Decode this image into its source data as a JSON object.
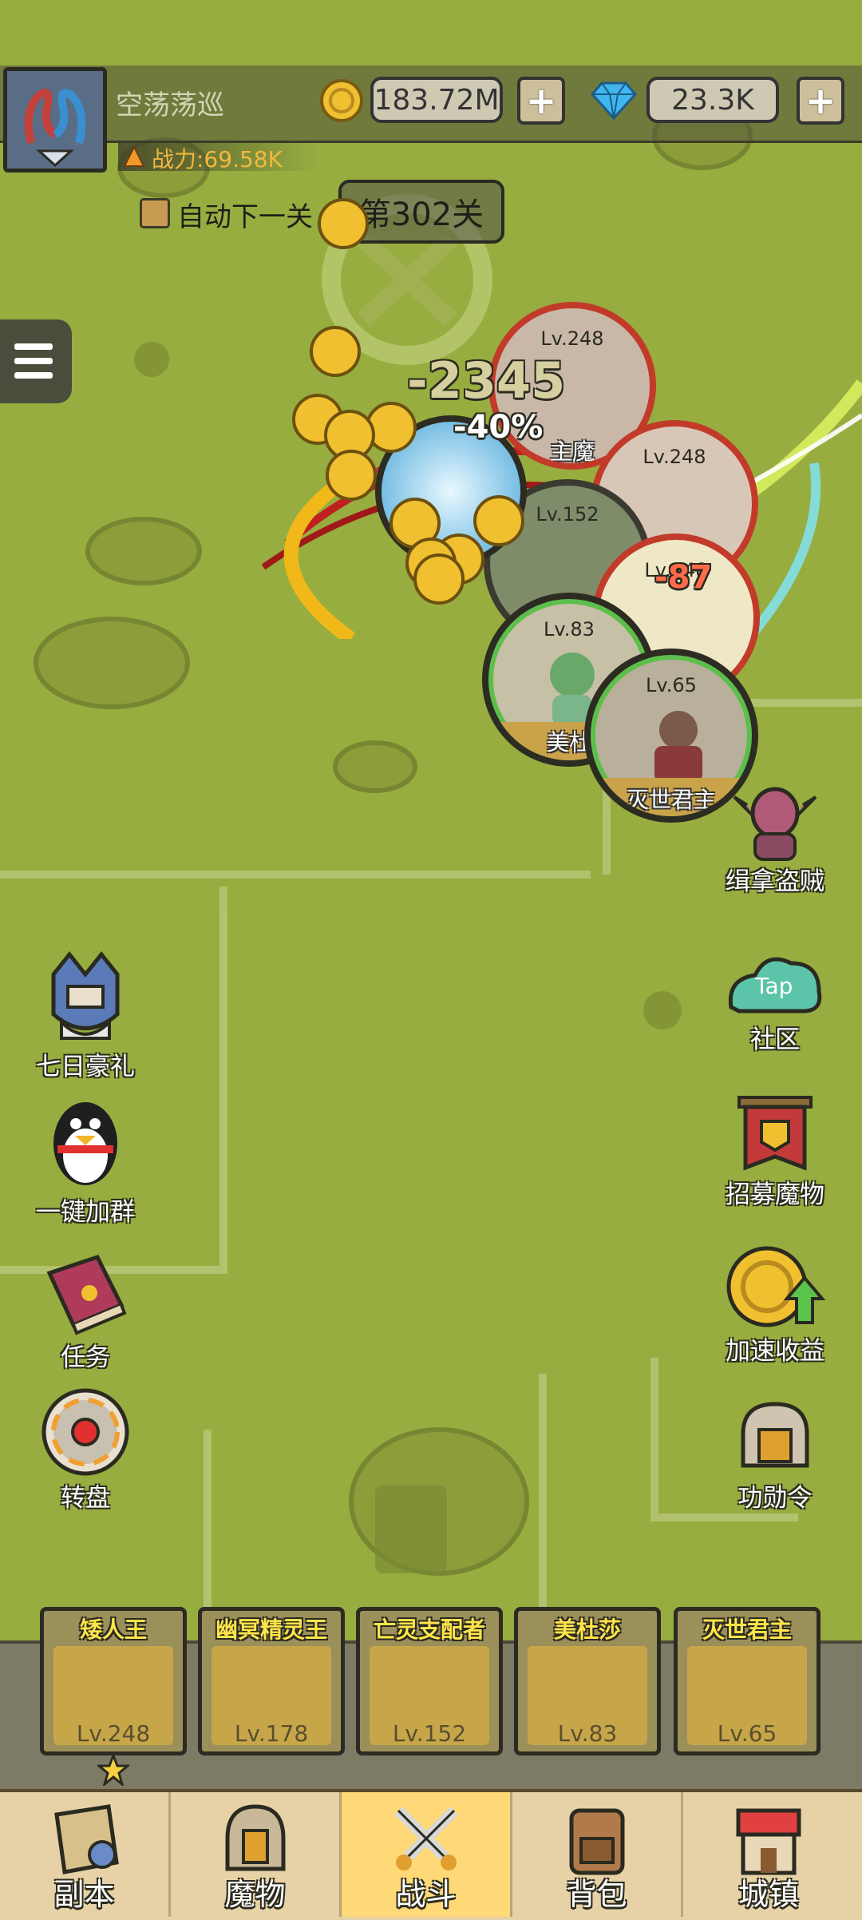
{
  "player": {
    "name": "空荡荡巡",
    "power": "战力:69.58K"
  },
  "currency": {
    "gold": "183.72M",
    "gems": "23.3K",
    "plus": "+"
  },
  "stage": {
    "auto_next_label": "自动下一关",
    "stage_label": "第302关"
  },
  "battle": {
    "damage_text": "-2345",
    "buff_text": "-40%",
    "small_damage": "-87",
    "monsters": [
      {
        "level": "Lv.248",
        "name": "主魔"
      },
      {
        "level": "Lv.248",
        "name": ""
      },
      {
        "level": "Lv.152",
        "name": ""
      },
      {
        "level": "Lv.248",
        "name": ""
      },
      {
        "level": "Lv.83",
        "name": "美杜"
      },
      {
        "level": "Lv.65",
        "name": "灭世君主"
      }
    ]
  },
  "left_buttons": [
    {
      "label": "七日豪礼",
      "icon": "knight-helmet-icon"
    },
    {
      "label": "一键加群",
      "icon": "penguin-icon"
    },
    {
      "label": "任务",
      "icon": "quest-book-icon"
    },
    {
      "label": "转盘",
      "icon": "roulette-wheel-icon"
    }
  ],
  "right_buttons": [
    {
      "label": "缉拿盗贼",
      "icon": "goblin-thief-icon"
    },
    {
      "label": "社区",
      "icon": "taptap-icon",
      "icon_text": "Tap"
    },
    {
      "label": "招募魔物",
      "icon": "recruit-banner-icon"
    },
    {
      "label": "加速收益",
      "icon": "gold-coin-boost-icon"
    },
    {
      "label": "功勋令",
      "icon": "merit-helmet-icon"
    }
  ],
  "heroes": [
    {
      "name": "矮人王",
      "level": "Lv.248"
    },
    {
      "name": "幽冥精灵王",
      "level": "Lv.178"
    },
    {
      "name": "亡灵支配者",
      "level": "Lv.152"
    },
    {
      "name": "美杜莎",
      "level": "Lv.83"
    },
    {
      "name": "灭世君主",
      "level": "Lv.65"
    }
  ],
  "nav": [
    {
      "label": "副本",
      "active": false
    },
    {
      "label": "魔物",
      "active": false
    },
    {
      "label": "战斗",
      "active": true
    },
    {
      "label": "背包",
      "active": false
    },
    {
      "label": "城镇",
      "active": false
    }
  ],
  "colors": {
    "grass": "#97ad3f",
    "gold": "#f0c030",
    "gem": "#3fb6ef",
    "active_tab": "#ffd977"
  }
}
